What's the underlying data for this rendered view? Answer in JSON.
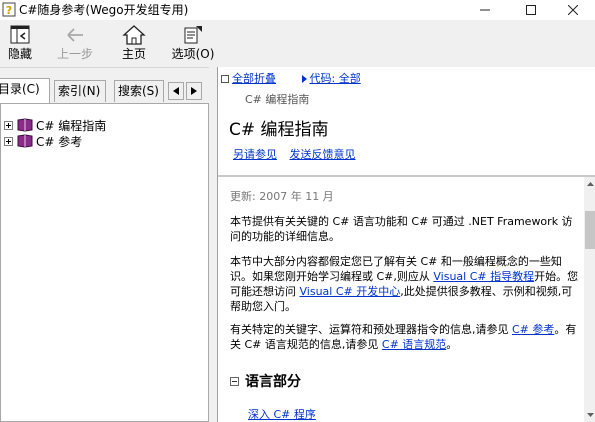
{
  "window": {
    "title": "C#随身参考(Wego开发组专用)"
  },
  "toolbar": {
    "hide_label": "隐藏",
    "back_label": "上一步",
    "home_label": "主页",
    "options_label": "选项(O)"
  },
  "nav": {
    "tabs": [
      "目录(C)",
      "索引(N)",
      "搜索(S)"
    ],
    "tree": [
      "C# 编程指南",
      "C# 参考"
    ]
  },
  "content": {
    "collapse_all": "全部折叠",
    "code_all": "代码: 全部",
    "breadcrumb": "C# 编程指南",
    "title": "C# 编程指南",
    "links": [
      "另请参见",
      "发送反馈意见"
    ],
    "updated": "更新: 2007 年 11 月",
    "para1": "本节提供有关关键的 C# 语言功能和 C# 可通过 .NET Framework 访问的功能的详细信息。",
    "para2": {
      "t1": "本节中大部分内容都假定您已了解有关 C# 和一般编程概念的一些知识。如果您刚开始学习编程或 C#,则应从 ",
      "l1": "Visual C# 指导教程",
      "t2": "开始。您可能还想访问 ",
      "l2": "Visual C# 开发中心",
      "t3": ",此处提供很多教程、示例和视频,可帮助您入门。"
    },
    "para3": {
      "t1": "有关特定的关键字、运算符和预处理器指令的信息,请参见 ",
      "l1": "C# 参考",
      "t2": "。有关 C# 语言规范的信息,请参见 ",
      "l2": "C# 语言规范",
      "t3": "。"
    },
    "section_title": "语言部分",
    "section_item": "深入 C# 程序"
  }
}
